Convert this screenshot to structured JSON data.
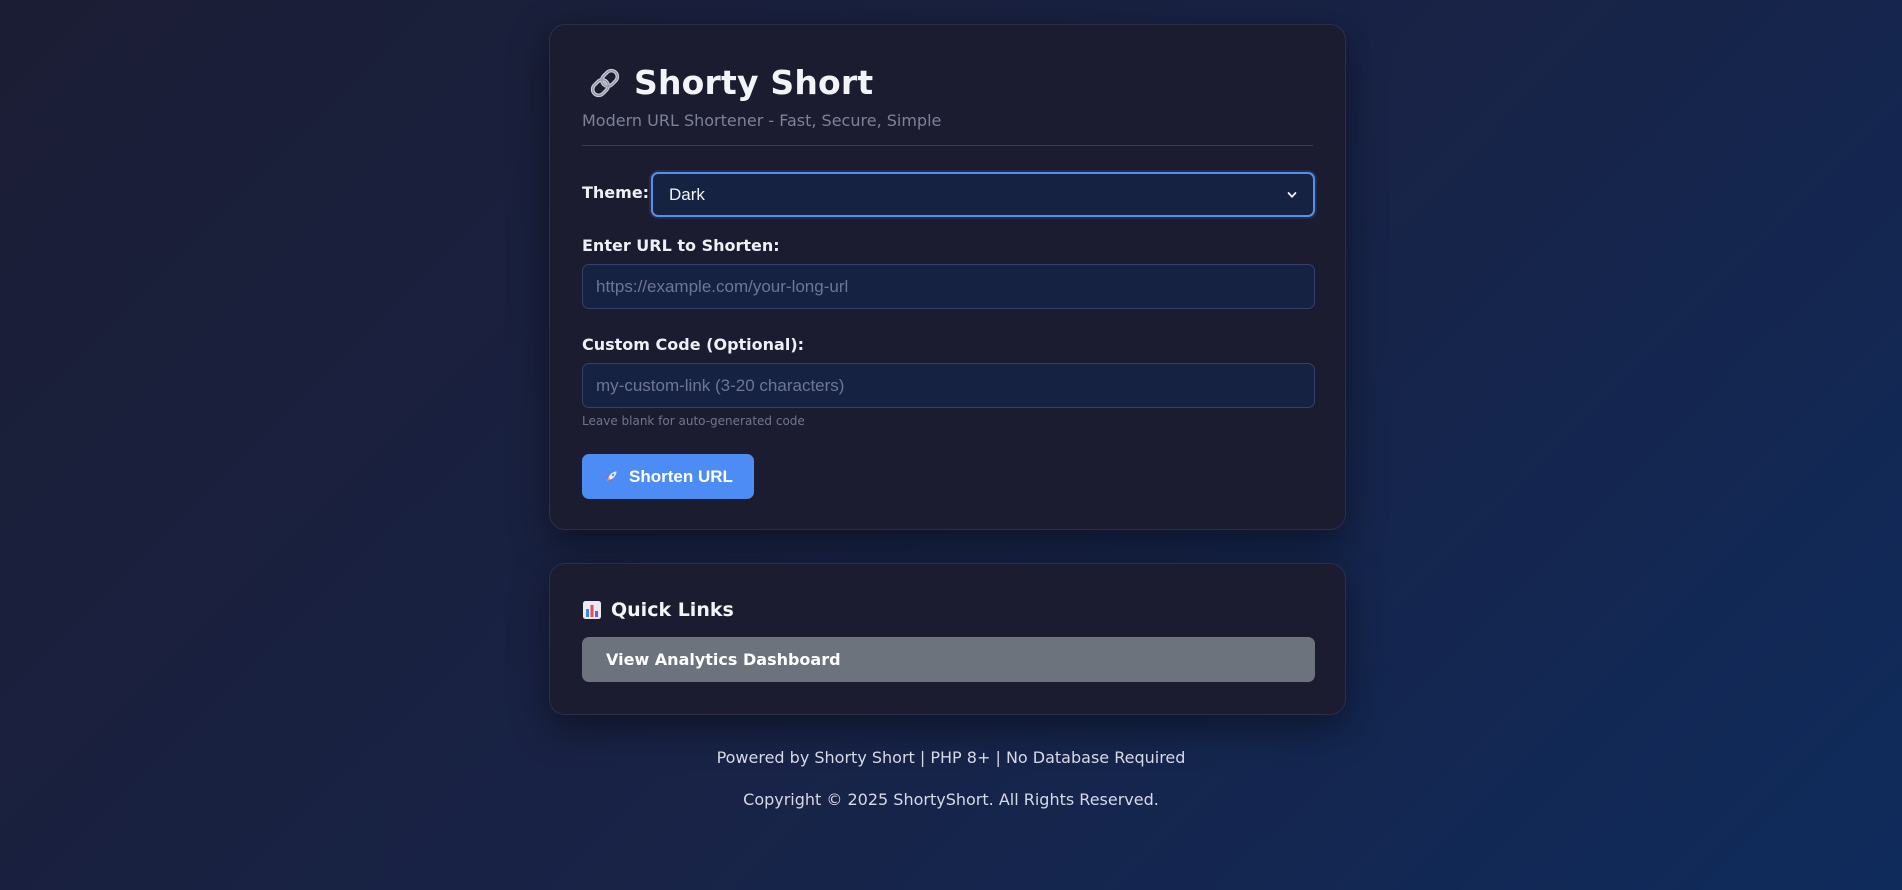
{
  "header": {
    "title": "Shorty Short",
    "subtitle": "Modern URL Shortener - Fast, Secure, Simple",
    "logo_icon": "link-icon"
  },
  "form": {
    "theme_label": "Theme:",
    "theme_value": "Dark",
    "url_label": "Enter URL to Shorten:",
    "url_placeholder": "https://example.com/your-long-url",
    "url_value": "",
    "code_label": "Custom Code (Optional):",
    "code_placeholder": "my-custom-link (3-20 characters)",
    "code_value": "",
    "code_hint": "Leave blank for auto-generated code",
    "submit_label": "Shorten URL",
    "submit_icon": "rocket-icon",
    "accent_color": "#4d8cf5"
  },
  "quick_links": {
    "title": "Quick Links",
    "title_icon": "bar-chart-icon",
    "items": [
      {
        "label": "View Analytics Dashboard"
      }
    ]
  },
  "footer": {
    "line1": "Powered by Shorty Short | PHP 8+ | No Database Required",
    "line2": "Copyright © 2025 ShortyShort. All Rights Reserved."
  }
}
